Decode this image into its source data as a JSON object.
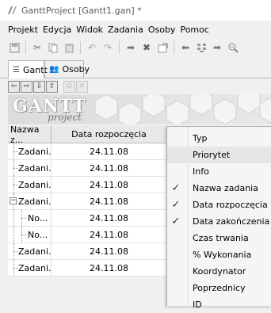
{
  "window": {
    "title": "GanttProject [Gantt1.gan] *"
  },
  "menu": [
    "Projekt",
    "Edycja",
    "Widok",
    "Zadania",
    "Osoby",
    "Pomoc"
  ],
  "toolbar_icons": [
    "save-icon",
    "cut-icon",
    "copy-icon",
    "paste-icon",
    "undo-icon",
    "redo-icon",
    "indent-icon",
    "delete-icon",
    "properties-icon",
    "outdent-icon",
    "link-icon",
    "next-icon",
    "zoom-out-icon"
  ],
  "tabs": [
    {
      "label": "Gantt",
      "icon": "gantt-icon",
      "active": true
    },
    {
      "label": "Osoby",
      "icon": "people-icon",
      "active": false
    }
  ],
  "logo": {
    "brand": "GANTT",
    "sub": "project"
  },
  "grid": {
    "headers": [
      "Nazwa z...",
      "Data rozpoczęcia"
    ],
    "rows": [
      {
        "name": "Zadani...",
        "date": "24.11.08",
        "level": 0,
        "expander": false
      },
      {
        "name": "Zadani...",
        "date": "24.11.08",
        "level": 0,
        "expander": false
      },
      {
        "name": "Zadani...",
        "date": "24.11.08",
        "level": 0,
        "expander": false
      },
      {
        "name": "Zadani...",
        "date": "24.11.08",
        "level": 0,
        "expander": true
      },
      {
        "name": "No...",
        "date": "24.11.08",
        "level": 1,
        "expander": false
      },
      {
        "name": "No...",
        "date": "24.11.08",
        "level": 1,
        "expander": false
      },
      {
        "name": "Zadani...",
        "date": "24.11.08",
        "level": 0,
        "expander": false
      },
      {
        "name": "Zadani...",
        "date": "24.11.08",
        "level": 0,
        "expander": false
      }
    ]
  },
  "column_menu": [
    {
      "label": "Typ",
      "checked": false
    },
    {
      "label": "Priorytet",
      "checked": false,
      "highlighted": true
    },
    {
      "label": "Info",
      "checked": false
    },
    {
      "label": "Nazwa zadania",
      "checked": true
    },
    {
      "label": "Data rozpoczęcia",
      "checked": true
    },
    {
      "label": "Data zakończenia",
      "checked": true
    },
    {
      "label": "Czas trwania",
      "checked": false
    },
    {
      "label": "% Wykonania",
      "checked": false
    },
    {
      "label": "Koordynator",
      "checked": false
    },
    {
      "label": "Poprzednicy",
      "checked": false
    },
    {
      "label": "ID",
      "checked": false
    }
  ],
  "checkmark": "✓"
}
